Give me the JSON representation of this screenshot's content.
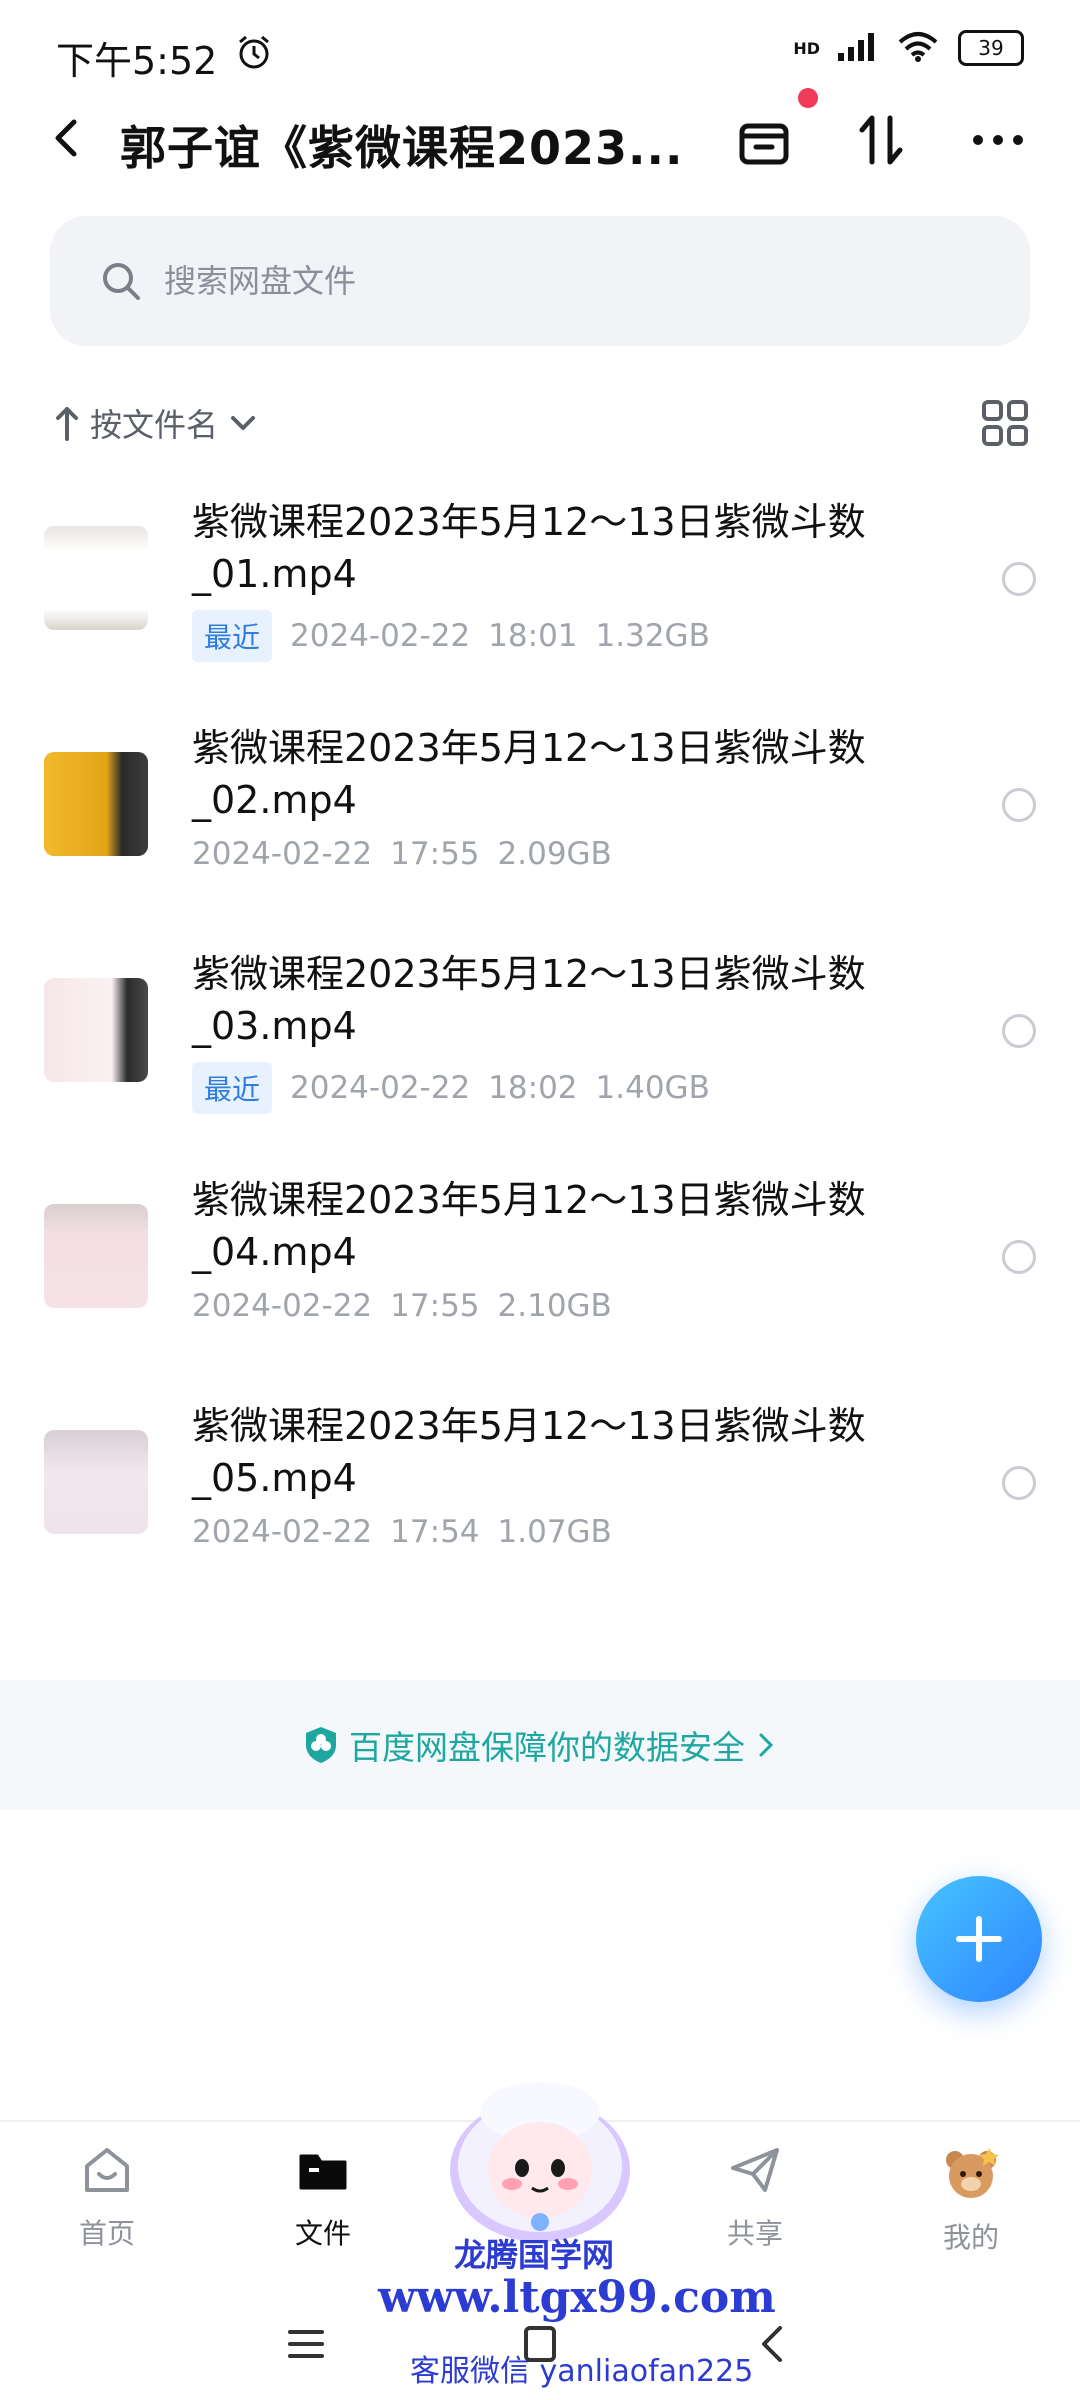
{
  "status_bar": {
    "time": "下午5:52",
    "network": "HD",
    "battery": "39"
  },
  "header": {
    "title": "郭子谊《紫微课程2023..."
  },
  "search": {
    "placeholder": "搜索网盘文件"
  },
  "sort": {
    "label": "按文件名"
  },
  "files": [
    {
      "name": "紫微课程2023年5月12～13日紫微斗数_01.mp4",
      "tag": "最近",
      "date": "2024-02-22",
      "time": "18:01",
      "size": "1.32GB"
    },
    {
      "name": "紫微课程2023年5月12～13日紫微斗数_02.mp4",
      "tag": "",
      "date": "2024-02-22",
      "time": "17:55",
      "size": "2.09GB"
    },
    {
      "name": "紫微课程2023年5月12～13日紫微斗数_03.mp4",
      "tag": "最近",
      "date": "2024-02-22",
      "time": "18:02",
      "size": "1.40GB"
    },
    {
      "name": "紫微课程2023年5月12～13日紫微斗数_04.mp4",
      "tag": "",
      "date": "2024-02-22",
      "time": "17:55",
      "size": "2.10GB"
    },
    {
      "name": "紫微课程2023年5月12～13日紫微斗数_05.mp4",
      "tag": "",
      "date": "2024-02-22",
      "time": "17:54",
      "size": "1.07GB"
    }
  ],
  "banner": {
    "text": "百度网盘保障你的数据安全"
  },
  "nav": {
    "home": "首页",
    "files": "文件",
    "share": "共享",
    "me": "我的"
  },
  "watermark": {
    "title": "龙腾国学网",
    "url": "www.ltgx99.com",
    "contact": "客服微信 yanliaofan225"
  },
  "colors": {
    "accent": "#2e84ff",
    "tag_bg": "#e8f2ff",
    "tag_text": "#2f7dde",
    "banner_text": "#1ea7a0",
    "badge": "#ef3b5a"
  }
}
